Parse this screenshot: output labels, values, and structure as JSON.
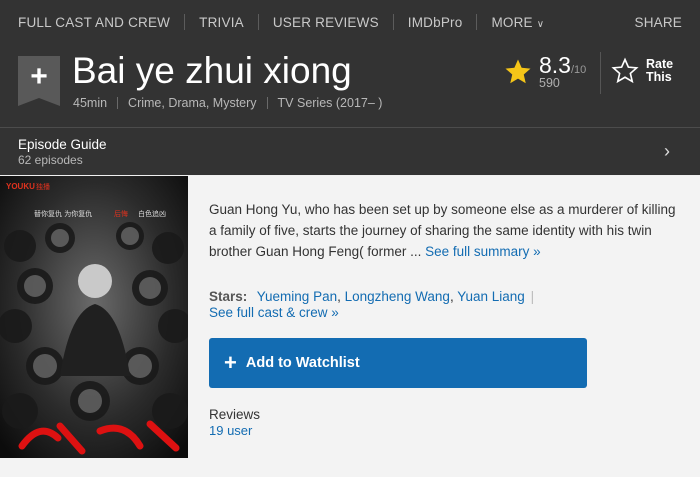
{
  "nav": {
    "items": [
      "FULL CAST AND CREW",
      "TRIVIA",
      "USER REVIEWS",
      "IMDbPro",
      "MORE"
    ],
    "share": "SHARE"
  },
  "title": {
    "add_icon": "plus-icon",
    "text": "Bai ye zhui xiong",
    "runtime": "45min",
    "genres": "Crime, Drama, Mystery",
    "type": "TV Series (2017– )"
  },
  "rating": {
    "value": "8.3",
    "out_of": "/10",
    "votes": "590",
    "star_color": "#f5c518",
    "rate_label_1": "Rate",
    "rate_label_2": "This"
  },
  "episodes": {
    "title": "Episode Guide",
    "count": "62 episodes"
  },
  "poster": {
    "logo": "YOUKU",
    "logo_sub": "独播",
    "tagline_left": "替你复仇  为你复仇",
    "tagline_right": "后悔",
    "tagline_right2": "白色追凶"
  },
  "summary": {
    "text": "Guan Hong Yu, who has been set up by someone else as a murderer of killing a family of five, starts the journey of sharing the same identity with his twin brother Guan Hong Feng( former ...",
    "more_link": "See full summary »"
  },
  "stars": {
    "label": "Stars:",
    "names": [
      "Yueming Pan",
      "Longzheng Wang",
      "Yuan Liang"
    ],
    "full_cast_link": "See full cast & crew »"
  },
  "watchlist": {
    "label": "Add to Watchlist",
    "accent": "#136cb2"
  },
  "reviews": {
    "title": "Reviews",
    "count": "19 user"
  }
}
